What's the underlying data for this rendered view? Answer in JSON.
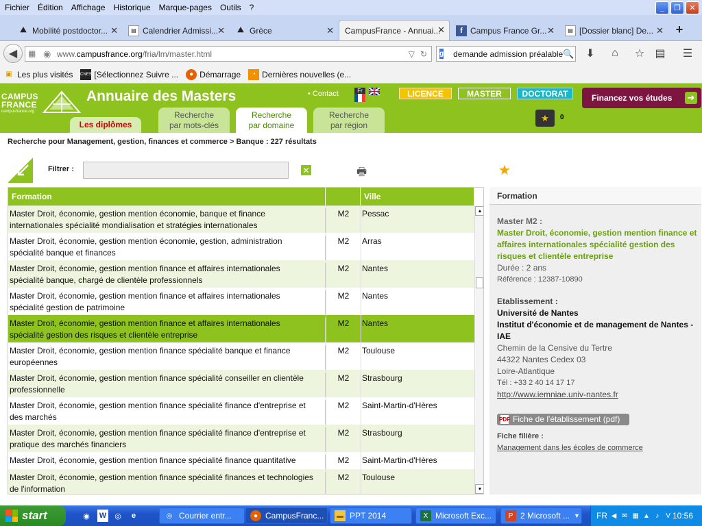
{
  "menubar": {
    "items": [
      "Fichier",
      "Édition",
      "Affichage",
      "Historique",
      "Marque-pages",
      "Outils",
      "?"
    ]
  },
  "tabs": [
    {
      "label": "Mobilité postdoctor...",
      "icon": "campusfrance-icon"
    },
    {
      "label": "Calendrier Admissi...",
      "icon": "page-icon"
    },
    {
      "label": "Grèce",
      "icon": "campusfrance-icon"
    },
    {
      "label": "CampusFrance - Annuai...",
      "icon": "none",
      "active": true
    },
    {
      "label": "Campus France Gr...",
      "icon": "facebook-icon"
    },
    {
      "label": "[Dossier blanc] De...",
      "icon": "page-icon"
    }
  ],
  "navbar": {
    "url_prefix": "www.",
    "url_domain": "campusfrance.org",
    "url_path": "/fria/lm/master.html",
    "search_value": "demande admission préalable"
  },
  "bookmarks": [
    {
      "label": "Les plus visités",
      "icon": "star-folder-icon"
    },
    {
      "label": "[Sélectionnez Suivre ...",
      "icon": "cnes-icon"
    },
    {
      "label": "Démarrage",
      "icon": "firefox-icon"
    },
    {
      "label": "Dernières nouvelles (e...",
      "icon": "rss-icon"
    }
  ],
  "site": {
    "logo_text_1": "CAMPUS",
    "logo_text_2": "FRANCE",
    "logo_sub": "campusfrance.org",
    "title": "Annuaire des Masters",
    "contact": "• Contact",
    "flag_fr_label": "Fr",
    "level_buttons": {
      "licence": "LICENCE",
      "master": "MASTER",
      "doctorat": "DOCTORAT"
    },
    "financez": "Financez vos études",
    "search_tabs": {
      "diplomes": "Les diplômes",
      "motscles_1": "Recherche",
      "motscles_2": "par mots-clés",
      "domaine_1": "Recherche",
      "domaine_2": "par domaine",
      "region_1": "Recherche",
      "region_2": "par région"
    },
    "cart_count": "0"
  },
  "breadcrumb": {
    "text": "Recherche pour Management, gestion, finances et commerce > Banque : 227 résultats"
  },
  "filter": {
    "label": "Filtrer :",
    "value": ""
  },
  "results": {
    "headers": {
      "formation": "Formation",
      "level": "",
      "city": "Ville"
    },
    "rows": [
      {
        "formation_1": "Master Droit, économie, gestion mention économie, banque et finance",
        "formation_2": "internationales spécialité mondialisation et stratégies internationales",
        "level": "M2",
        "city": "Pessac"
      },
      {
        "formation_1": "Master Droit, économie, gestion mention économie, gestion, administration",
        "formation_2": "spécialité banque et finances",
        "level": "M2",
        "city": "Arras"
      },
      {
        "formation_1": "Master Droit, économie, gestion mention finance et affaires internationales",
        "formation_2": "spécialité banque, chargé de clientèle professionnels",
        "level": "M2",
        "city": "Nantes"
      },
      {
        "formation_1": "Master Droit, économie, gestion mention finance et affaires internationales",
        "formation_2": "spécialité gestion de patrimoine",
        "level": "M2",
        "city": "Nantes"
      },
      {
        "formation_1": "Master Droit, économie, gestion mention finance et affaires internationales",
        "formation_2": "spécialité gestion des risques et clientèle entreprise",
        "level": "M2",
        "city": "Nantes"
      },
      {
        "formation_1": "Master Droit, économie, gestion mention finance spécialité banque et finance",
        "formation_2": "européennes",
        "level": "M2",
        "city": "Toulouse"
      },
      {
        "formation_1": "Master Droit, économie, gestion mention finance spécialité conseiller en clientèle",
        "formation_2": "professionnelle",
        "level": "M2",
        "city": "Strasbourg"
      },
      {
        "formation_1": "Master Droit, économie, gestion mention finance spécialité finance d'entreprise et",
        "formation_2": "des marchés",
        "level": "M2",
        "city": "Saint-Martin-d'Hères"
      },
      {
        "formation_1": "Master Droit, économie, gestion mention finance spécialité finance d'entreprise et",
        "formation_2": "pratique des marchés financiers",
        "level": "M2",
        "city": "Strasbourg"
      },
      {
        "formation_1": "Master Droit, économie, gestion mention finance spécialité finance quantitative",
        "formation_2": "",
        "level": "M2",
        "city": "Saint-Martin-d'Hères"
      },
      {
        "formation_1": "Master Droit, économie, gestion mention finance spécialité finances et technologies",
        "formation_2": "de l'information",
        "level": "M2",
        "city": "Toulouse"
      }
    ]
  },
  "detail": {
    "header": "Formation",
    "level": "Master M2 :",
    "title": "Master Droit, économie, gestion mention finance et affaires internationales spécialité gestion des risques et clientèle entreprise",
    "duree": "Durée : 2 ans",
    "reference": "Référence : 12387-10890",
    "etab_label": "Etablissement :",
    "etab_name": "Université de Nantes",
    "etab_inst": "Institut d'économie et de management de Nantes - IAE",
    "addr_1": "Chemin de la Censive du Tertre",
    "addr_2": "44322 Nantes Cedex 03",
    "addr_3": "Loire-Atlantique",
    "tel": "Tél : +33 2 40 14 17 17",
    "website": "http://www.iemniae.univ-nantes.fr",
    "pdf_button": "Fiche de l'établissement (pdf)",
    "filiere_label": "Fiche filière :",
    "filiere_link": "Management dans les écoles de commerce"
  },
  "taskbar": {
    "start": "start",
    "tasks": [
      {
        "label": "Courrier entr...",
        "icon": "outlook-icon"
      },
      {
        "label": "CampusFranc...",
        "icon": "firefox-icon",
        "active": true
      },
      {
        "label": "PPT 2014",
        "icon": "folder-icon"
      },
      {
        "label": "Microsoft Exc...",
        "icon": "excel-icon"
      },
      {
        "label": "2 Microsoft ...",
        "icon": "powerpoint-icon"
      }
    ],
    "lang": "FR",
    "clock": "10:56"
  },
  "colors": {
    "site_green": "#8dc21f",
    "licence_yellow": "#f5c400",
    "doctorat_cyan": "#17b8c9",
    "financez_maroon": "#7c1540",
    "selected_row": "#8dc21f",
    "detail_title": "#6aa00f"
  }
}
